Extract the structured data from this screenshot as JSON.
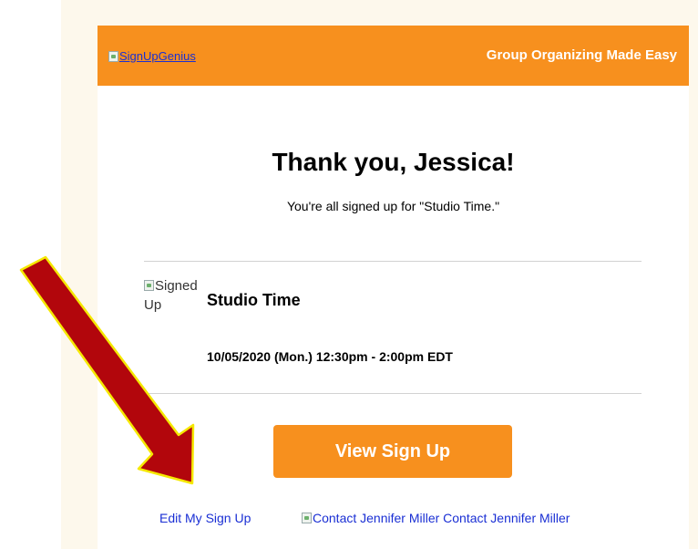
{
  "colors": {
    "brand_orange": "#f7901e",
    "link_blue": "#1a2fd4",
    "page_cream": "#fdf8ec",
    "arrow_red": "#b2060c",
    "arrow_outline": "#f5e800"
  },
  "header": {
    "logo_alt": "SignUpGenius",
    "tagline": "Group Organizing Made Easy"
  },
  "confirmation": {
    "heading": "Thank you, Jessica!",
    "message": "You're all signed up for \"Studio Time.\""
  },
  "event": {
    "image_alt": "Signed Up",
    "title": "Studio Time",
    "datetime": "10/05/2020 (Mon.) 12:30pm - 2:00pm EDT"
  },
  "actions": {
    "view_button": "View Sign Up",
    "edit_link": "Edit My Sign Up",
    "contact_link": "Contact Jennifer Miller Contact Jennifer Miller"
  },
  "annotation": {
    "arrow_icon": "arrow-pointing-down-right-icon"
  }
}
